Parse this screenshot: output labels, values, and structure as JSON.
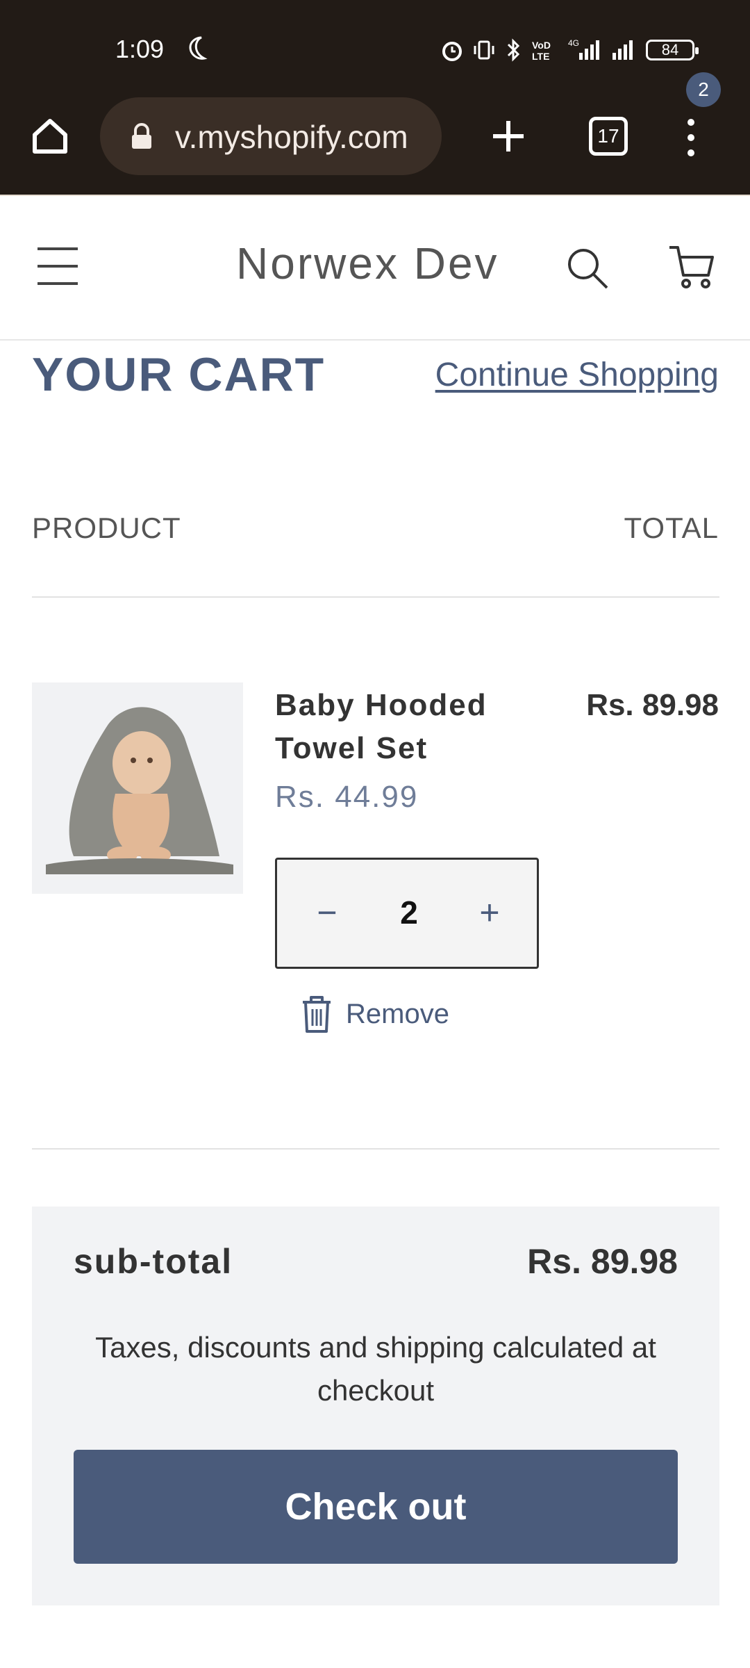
{
  "status_bar": {
    "time": "1:09",
    "network": "4G",
    "battery": "84"
  },
  "browser": {
    "url": "v.myshopify.com",
    "tab_count": "17"
  },
  "store": {
    "brand": "Norwex Dev",
    "cart_count": "2"
  },
  "cart": {
    "title": "YOUR CART",
    "continue_label": "Continue Shopping",
    "col_product": "PRODUCT",
    "col_total": "TOTAL",
    "items": [
      {
        "name": "Baby Hooded Towel Set",
        "unit_price": "Rs. 44.99",
        "quantity": "2",
        "line_total": "Rs. 89.98",
        "remove_label": "Remove"
      }
    ]
  },
  "summary": {
    "subtotal_label": "sub-total",
    "subtotal_value": "Rs. 89.98",
    "tax_note": "Taxes, discounts and shipping calculated at checkout",
    "checkout_label": "Check out"
  },
  "colors": {
    "accent": "#4a5b7b",
    "browser_chrome": "#221b16"
  }
}
